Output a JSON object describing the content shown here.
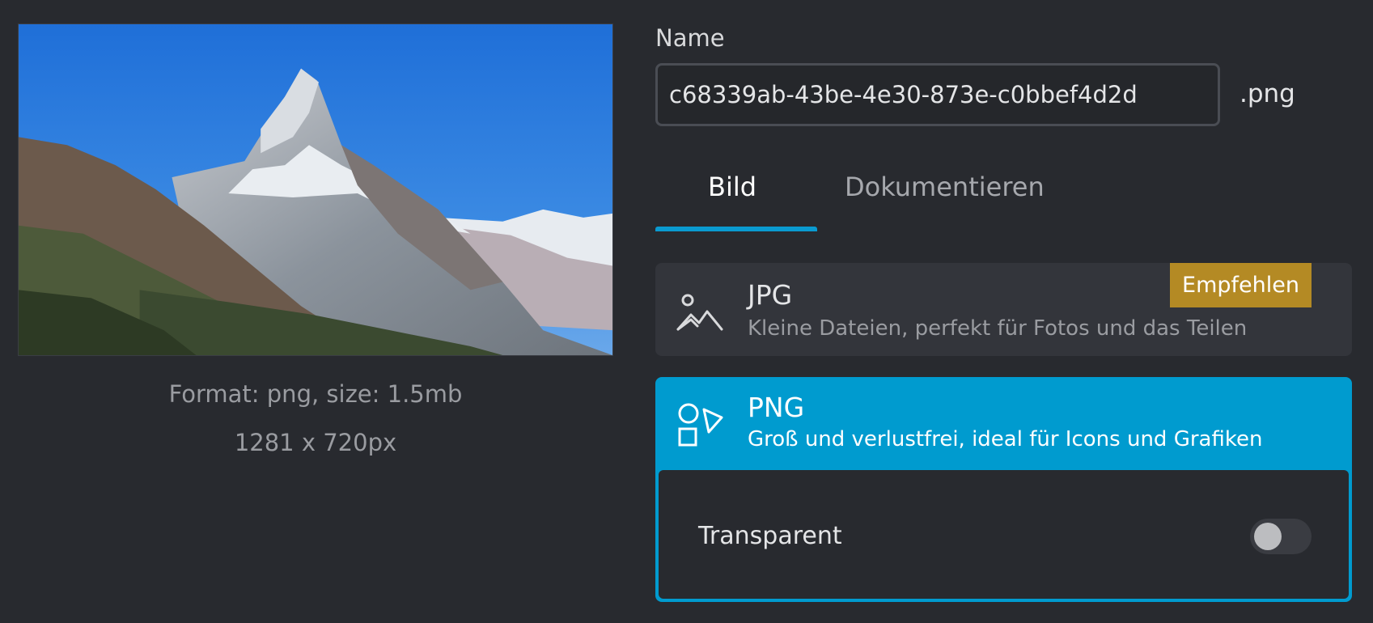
{
  "preview": {
    "format_text": "Format: png, size: 1.5mb",
    "dimensions_text": "1281 x 720px"
  },
  "name_field": {
    "label": "Name",
    "value": "c68339ab-43be-4e30-873e-c0bbef4d2d",
    "extension": ".png"
  },
  "tabs": [
    {
      "label": "Bild",
      "active": true
    },
    {
      "label": "Dokumentieren",
      "active": false
    }
  ],
  "formats": [
    {
      "title": "JPG",
      "description": "Kleine Dateien, perfekt für Fotos und das Teilen",
      "badge": "Empfehlen",
      "icon": "image-mountain-icon",
      "selected": false
    },
    {
      "title": "PNG",
      "description": "Groß und verlustfrei, ideal für Icons und Grafiken",
      "icon": "shapes-icon",
      "selected": true,
      "options": {
        "transparent_label": "Transparent",
        "transparent_enabled": false
      }
    }
  ],
  "colors": {
    "background": "#282a2f",
    "accent": "#009bcf",
    "badge": "#b48a24",
    "card": "#33353b"
  }
}
